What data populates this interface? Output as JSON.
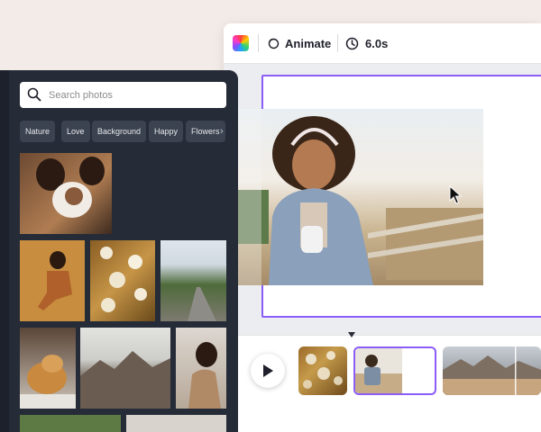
{
  "editor": {
    "toolbar": {
      "color_icon": "color-palette-icon",
      "animate_label": "Animate",
      "duration_label": "6.0s"
    }
  },
  "photo_panel": {
    "search": {
      "placeholder": "Search photos",
      "value": ""
    },
    "chips": [
      "Nature",
      "Love",
      "Background",
      "Happy",
      "Flowers"
    ]
  },
  "colors": {
    "accent": "#8b5cf6",
    "panel_bg": "#252b37",
    "chip_bg": "#3c4350"
  }
}
